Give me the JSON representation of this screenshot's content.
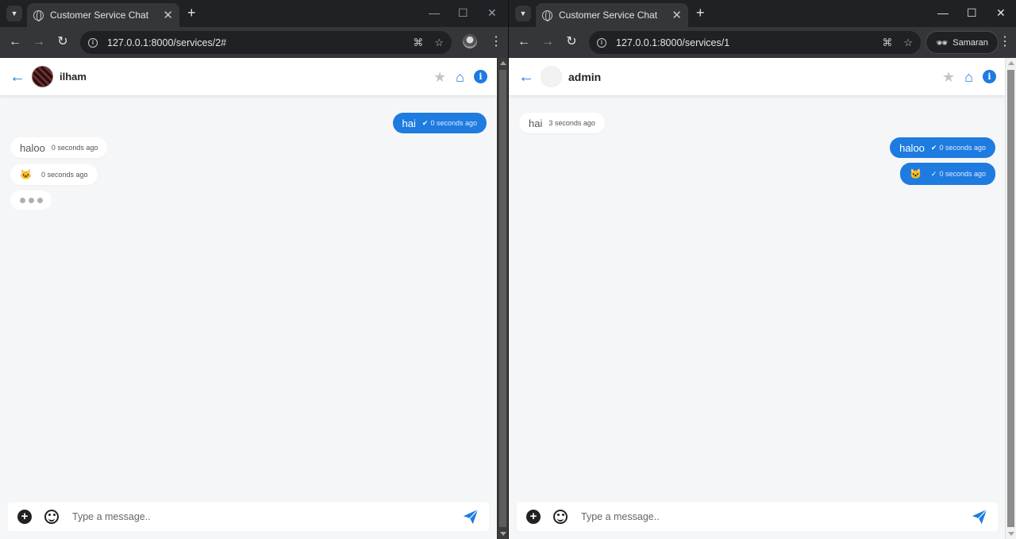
{
  "windows": [
    {
      "tab_title": "Customer Service Chat",
      "url": "127.0.0.1:8000/services/2#",
      "profile_label": "",
      "contact_name": "ilham",
      "composer_placeholder": "Type a message..",
      "messages": [
        {
          "dir": "out",
          "text": "hai",
          "time": "0 seconds ago",
          "status": "read"
        },
        {
          "dir": "in",
          "text": "haloo",
          "time": "0 seconds ago"
        },
        {
          "dir": "in",
          "emoji": "🐱",
          "time": "0 seconds ago"
        }
      ],
      "typing_indicator": true
    },
    {
      "tab_title": "Customer Service Chat",
      "url": "127.0.0.1:8000/services/1",
      "profile_label": "Samaran",
      "contact_name": "admin",
      "composer_placeholder": "Type a message..",
      "messages": [
        {
          "dir": "in",
          "text": "hai",
          "time": "3 seconds ago"
        },
        {
          "dir": "out",
          "text": "haloo",
          "time": "0 seconds ago",
          "status": "read"
        },
        {
          "dir": "out",
          "emoji": "🐱",
          "time": "0 seconds ago",
          "status": "sent"
        }
      ],
      "typing_indicator": false
    }
  ],
  "colors": {
    "accent": "#1e7be0",
    "page_bg": "#f5f6f8",
    "chrome_dark": "#202124",
    "chrome_toolbar": "#35363a"
  },
  "icons": {
    "back": "arrow-left-icon",
    "favorite": "star-icon",
    "home": "home-icon",
    "info": "info-icon",
    "attach": "plus-circle-icon",
    "emoji": "smile-icon",
    "send": "paper-plane-icon"
  }
}
